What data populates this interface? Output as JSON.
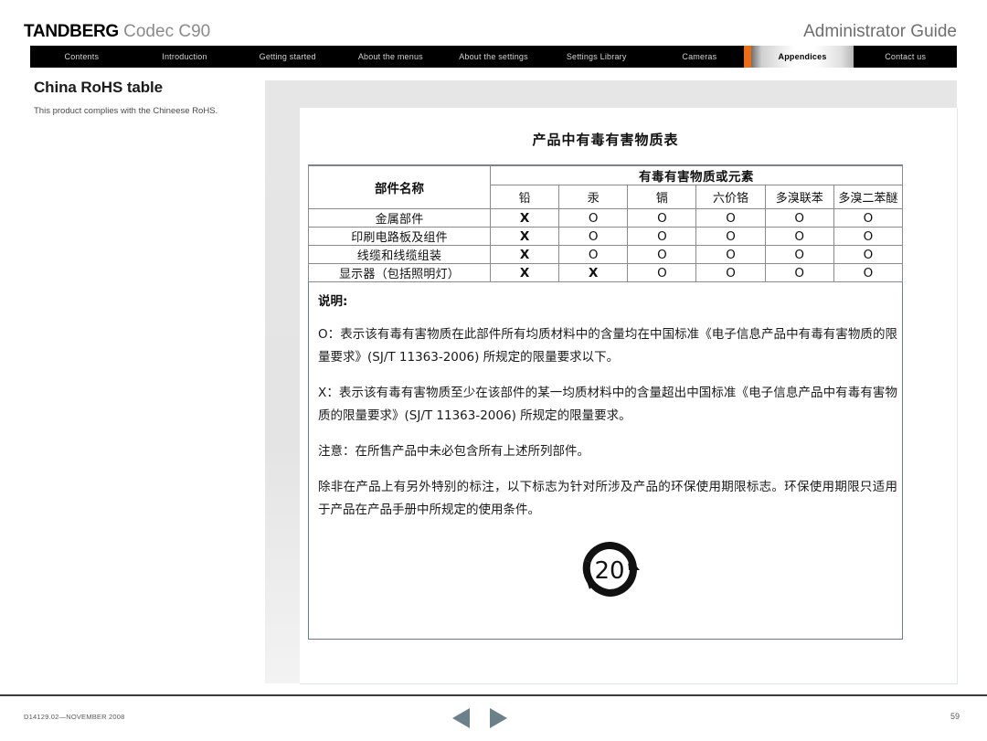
{
  "header": {
    "brand_main": "TANDBERG",
    "brand_sub": "Codec C90",
    "guide_title": "Administrator Guide"
  },
  "tabs": [
    {
      "label": "Contents",
      "active": false
    },
    {
      "label": "Introduction",
      "active": false
    },
    {
      "label": "Getting started",
      "active": false
    },
    {
      "label": "About the menus",
      "active": false
    },
    {
      "label": "About the settings",
      "active": false
    },
    {
      "label": "Settings Library",
      "active": false
    },
    {
      "label": "Cameras",
      "active": false
    },
    {
      "label": "Appendices",
      "active": true
    },
    {
      "label": "Contact us",
      "active": false
    }
  ],
  "left": {
    "page_title": "China RoHS table",
    "intro": "This product complies with the Chineese RoHS."
  },
  "document": {
    "heading": "产品中有毒有害物质表",
    "table": {
      "part_name_header": "部件名称",
      "group_header": "有毒有害物质或元素",
      "substance_headers": [
        "铅",
        "汞",
        "镉",
        "六价铬",
        "多溴联苯",
        "多溴二苯醚"
      ],
      "rows": [
        {
          "part": "金属部件",
          "marks": [
            "X",
            "O",
            "O",
            "O",
            "O",
            "O"
          ]
        },
        {
          "part": "印刷电路板及组件",
          "marks": [
            "X",
            "O",
            "O",
            "O",
            "O",
            "O"
          ]
        },
        {
          "part": "线缆和线缆组装",
          "marks": [
            "X",
            "O",
            "O",
            "O",
            "O",
            "O"
          ]
        },
        {
          "part": "显示器（包括照明灯）",
          "marks": [
            "X",
            "X",
            "O",
            "O",
            "O",
            "O"
          ]
        }
      ]
    },
    "notes": {
      "title": "说明:",
      "o_para": "O：表示该有毒有害物质在此部件所有均质材料中的含量均在中国标准《电子信息产品中有毒有害物质的限量要求》(SJ/T 11363-2006) 所规定的限量要求以下。",
      "x_para": "X：表示该有毒有害物质至少在该部件的某一均质材料中的含量超出中国标准《电子信息产品中有毒有害物质的限量要求》(SJ/T 11363-2006) 所规定的限量要求。",
      "attention_para": "注意：在所售产品中未必包含所有上述所列部件。",
      "epup_para": "除非在产品上有另外特别的标注，以下标志为针对所涉及产品的环保使用期限标志。环保使用期限只适用于产品在产品手册中所规定的使用条件。"
    },
    "epup_logo_value": "20"
  },
  "footer": {
    "doc_id": "D14129.02—NOVEMBER 2008",
    "page_number": "59",
    "prev_label": "prev-page-arrow",
    "next_label": "next-page-arrow"
  },
  "colors": {
    "accent_orange": "#f06c12",
    "tabbar_black": "#000000",
    "nav_arrow": "#6b8089"
  }
}
